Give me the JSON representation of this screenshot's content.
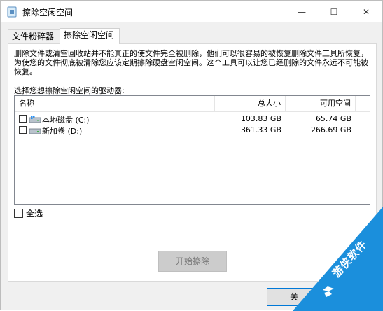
{
  "window": {
    "title": "擦除空闲空间",
    "minimize": "—",
    "maximize": "☐",
    "close": "✕"
  },
  "tabs": [
    {
      "label": "文件粉碎器",
      "active": false
    },
    {
      "label": "擦除空闲空间",
      "active": true
    }
  ],
  "description": "删除文件或清空回收站并不能真正的使文件完全被删除，他们可以很容易的被恢复删除文件工具所恢复，为使您的文件彻底被清除您应该定期擦除硬盘空闲空间。这个工具可以让您已经删除的文件永远不可能被恢复。",
  "drive_select_label": "选择您想擦除空闲空间的驱动器:",
  "table": {
    "columns": [
      "名称",
      "总大小",
      "可用空间"
    ],
    "rows": [
      {
        "name": "本地磁盘 (C:)",
        "total": "103.83 GB",
        "free": "65.74 GB",
        "checked": false,
        "icon": "system-drive-icon"
      },
      {
        "name": "新加卷 (D:)",
        "total": "361.33 GB",
        "free": "266.69 GB",
        "checked": false,
        "icon": "drive-icon"
      }
    ]
  },
  "select_all_label": "全选",
  "start_button": "开始擦除",
  "bottom_button": "关",
  "watermark": "游侠软件",
  "colors": {
    "accent": "#0078d7",
    "watermark": "#1b8fdc"
  }
}
